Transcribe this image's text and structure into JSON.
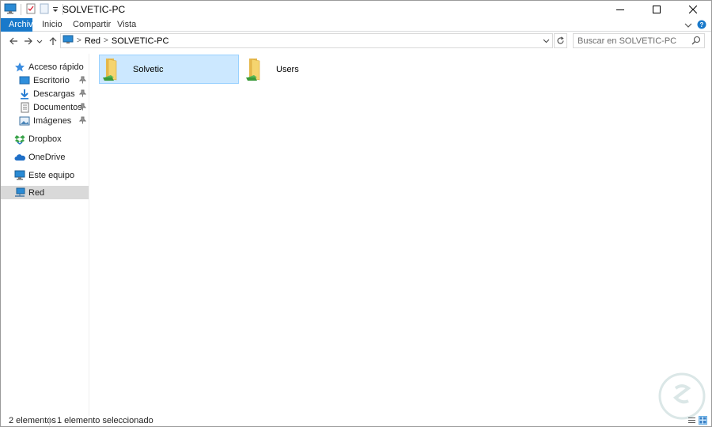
{
  "window": {
    "title": "SOLVETIC-PC"
  },
  "ribbon": {
    "tabs": [
      {
        "label": "Archivo",
        "active": true
      },
      {
        "label": "Inicio",
        "active": false
      },
      {
        "label": "Compartir",
        "active": false
      },
      {
        "label": "Vista",
        "active": false
      }
    ]
  },
  "address": {
    "crumbs": [
      "Red",
      "SOLVETIC-PC"
    ]
  },
  "search": {
    "placeholder": "Buscar en SOLVETIC-PC"
  },
  "sidebar": {
    "items": [
      {
        "label": "Acceso rápido",
        "icon": "star-icon"
      },
      {
        "label": "Escritorio",
        "icon": "desktop-icon",
        "pinned": true
      },
      {
        "label": "Descargas",
        "icon": "download-icon",
        "pinned": true
      },
      {
        "label": "Documentos",
        "icon": "documents-icon",
        "pinned": true
      },
      {
        "label": "Imágenes",
        "icon": "pictures-icon",
        "pinned": true
      },
      {
        "label": "Dropbox",
        "icon": "dropbox-icon"
      },
      {
        "label": "OneDrive",
        "icon": "onedrive-icon"
      },
      {
        "label": "Este equipo",
        "icon": "computer-icon"
      },
      {
        "label": "Red",
        "icon": "network-icon",
        "selected": true
      }
    ]
  },
  "content": {
    "items": [
      {
        "label": "Solvetic",
        "icon": "shared-folder-icon",
        "selected": true
      },
      {
        "label": "Users",
        "icon": "shared-folder-icon",
        "selected": false
      }
    ]
  },
  "status": {
    "count": "2 elementos",
    "selection": "1 elemento seleccionado"
  },
  "colors": {
    "accent": "#1979ca",
    "selection_bg": "#cce8ff",
    "selection_border": "#99d1ff",
    "sidebar_selected": "#d9d9d9"
  }
}
